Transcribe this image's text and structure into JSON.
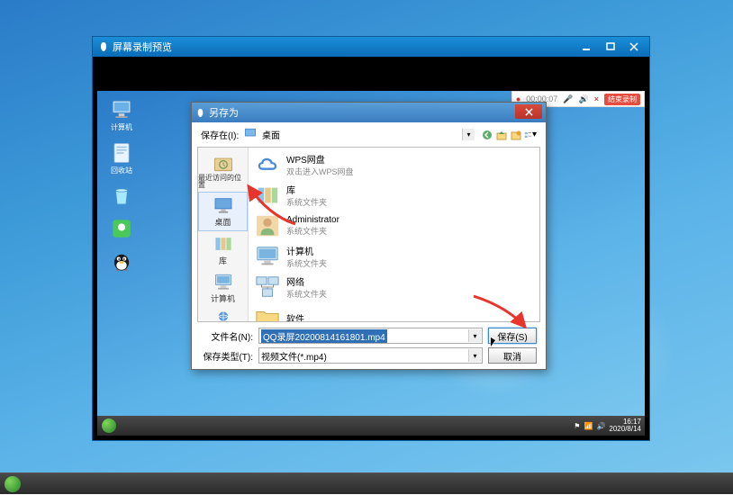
{
  "outer_desktop": {
    "visible": true
  },
  "preview_window": {
    "title": "屏幕录制预览"
  },
  "recording_toolbar": {
    "time": "00:00:07",
    "stop_label": "结束录制"
  },
  "desktop_icons": {
    "computer": "计算机",
    "recycle": "回收站",
    "app1": "",
    "qq": ""
  },
  "save_dialog": {
    "title": "另存为",
    "save_in_label": "保存在(I):",
    "save_in_value": "桌面",
    "sidebar": {
      "recent": "最近访问的位置",
      "desktop": "桌面",
      "libraries": "库",
      "computer": "计算机",
      "network": "网络"
    },
    "items": [
      {
        "name": "WPS网盘",
        "sub": "双击进入WPS网盘",
        "icon": "cloud"
      },
      {
        "name": "库",
        "sub": "系统文件夹",
        "icon": "folder-lib"
      },
      {
        "name": "Administrator",
        "sub": "系统文件夹",
        "icon": "user"
      },
      {
        "name": "计算机",
        "sub": "系统文件夹",
        "icon": "computer"
      },
      {
        "name": "网络",
        "sub": "系统文件夹",
        "icon": "network"
      },
      {
        "name": "软件",
        "sub": "",
        "icon": "folder"
      }
    ],
    "filename_label": "文件名(N):",
    "filename_value": "QQ录屏20200814161801.mp4",
    "filetype_label": "保存类型(T):",
    "filetype_value": "视频文件(*.mp4)",
    "save_button": "保存(S)",
    "cancel_button": "取消"
  },
  "inner_taskbar": {
    "time": "16:17",
    "date": "2020/8/14"
  }
}
